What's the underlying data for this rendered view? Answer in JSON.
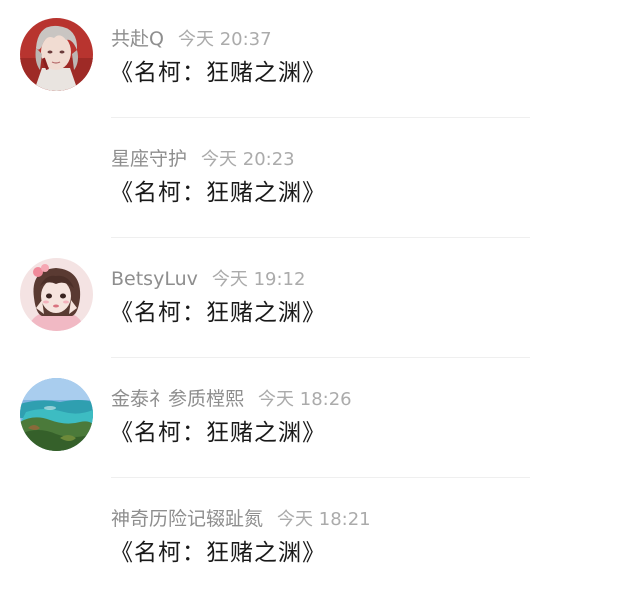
{
  "comments": [
    {
      "avatar": "avatar-anime-boy",
      "username": "共赴Q",
      "time": "今天 20:37",
      "message": "《名柯：狂赌之渊》"
    },
    {
      "avatar": "",
      "username": "星座守护",
      "time": "今天 20:23",
      "message": "《名柯：狂赌之渊》"
    },
    {
      "avatar": "avatar-anime-girl",
      "username": "BetsyLuv",
      "time": "今天 19:12",
      "message": "《名柯：狂赌之渊》"
    },
    {
      "avatar": "avatar-landscape",
      "username": "金泰礻参质樘熙",
      "time": "今天 18:26",
      "message": "《名柯：狂赌之渊》"
    },
    {
      "avatar": "",
      "username": "神奇历险记辍趾氮",
      "time": "今天 18:21",
      "message": "《名柯：狂赌之渊》"
    }
  ]
}
